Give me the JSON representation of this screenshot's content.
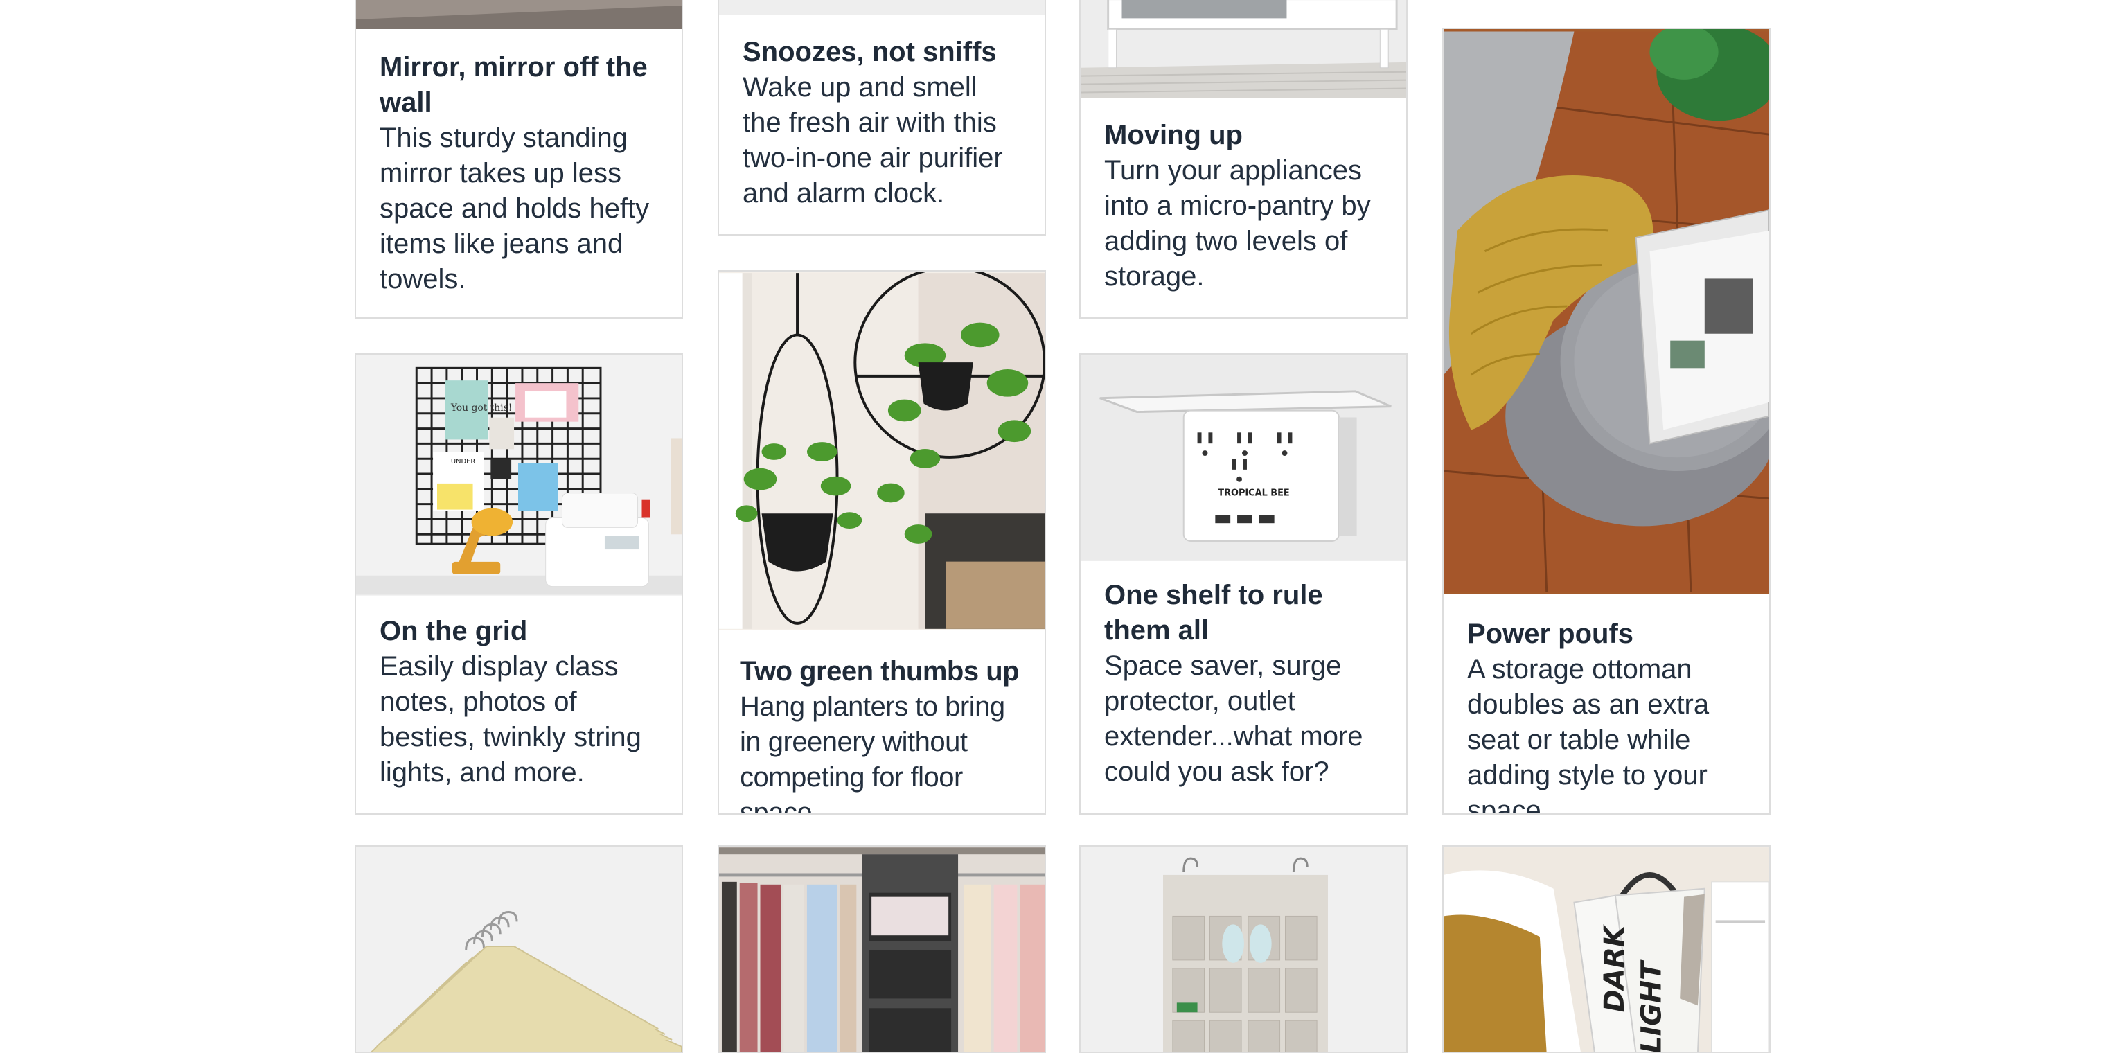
{
  "cards": [
    {
      "title": "Mirror, mirror off the wall",
      "body": "This sturdy standing mirror takes up less space and holds hefty items like jeans and towels."
    },
    {
      "title": "Snoozes, not sniffs",
      "body": "Wake up and smell the fresh air with this two-in-one air purifier and alarm clock."
    },
    {
      "title": "Moving up",
      "body": "Turn your appliances into a micro-pantry by adding two levels of storage."
    },
    {
      "title": "Power poufs",
      "body": "A storage ottoman doubles as an extra seat or table while adding style to your space."
    },
    {
      "title": "On the grid",
      "body": "Easily display class notes, photos of besties, twinkly string lights, and more."
    },
    {
      "title": "Two green thumbs up",
      "body": "Hang planters to bring in greenery without competing for floor space."
    },
    {
      "title": "One shelf to rule them all",
      "body": "Space saver, surge protector, outlet extender...what more could you ask for?"
    }
  ],
  "images": {
    "grid_note_1": "You got this!",
    "grid_note_2": "UNDER",
    "outlet_brand": "TROPICAL BEE",
    "hamper_word_1": "DARK",
    "hamper_word_2": "LIGHT"
  }
}
